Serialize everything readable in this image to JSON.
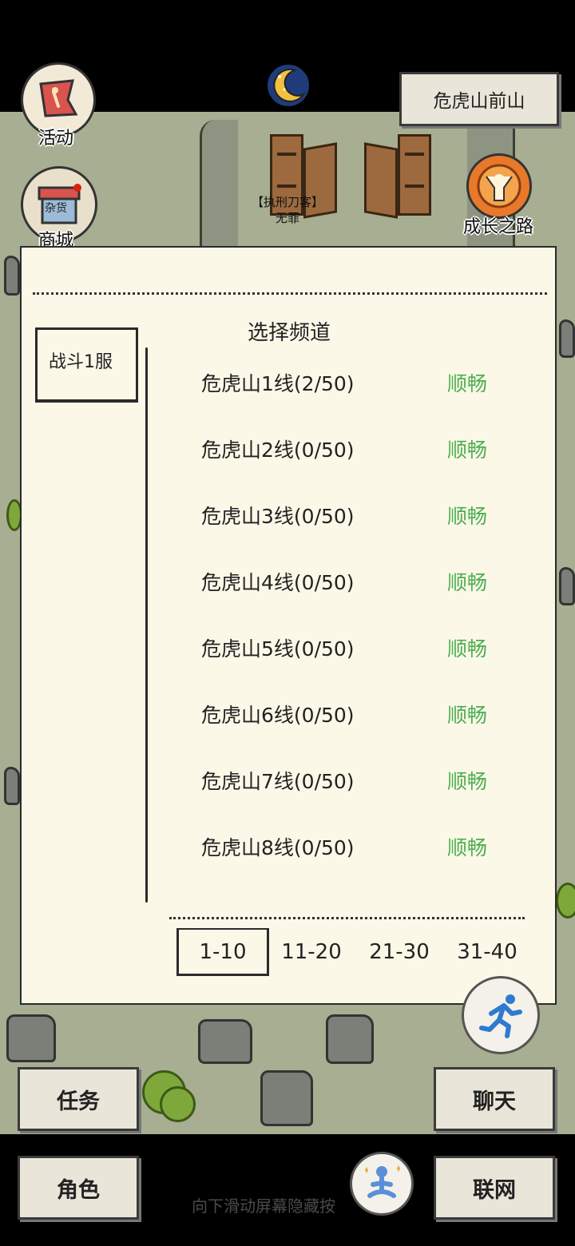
{
  "top": {
    "location": "危虎山前山",
    "activity_label": "活动",
    "shop_label": "商城",
    "shop_sign": "杂货",
    "growth_label": "成长之路"
  },
  "npc": {
    "title": "【执刑刀客】",
    "name": "无罪"
  },
  "dialog": {
    "server_tab": "战斗1服",
    "title": "选择频道",
    "channels": [
      {
        "name": "危虎山1线(2/50)",
        "status": "顺畅"
      },
      {
        "name": "危虎山2线(0/50)",
        "status": "顺畅"
      },
      {
        "name": "危虎山3线(0/50)",
        "status": "顺畅"
      },
      {
        "name": "危虎山4线(0/50)",
        "status": "顺畅"
      },
      {
        "name": "危虎山5线(0/50)",
        "status": "顺畅"
      },
      {
        "name": "危虎山6线(0/50)",
        "status": "顺畅"
      },
      {
        "name": "危虎山7线(0/50)",
        "status": "顺畅"
      },
      {
        "name": "危虎山8线(0/50)",
        "status": "顺畅"
      }
    ],
    "pages": [
      "1-10",
      "11-20",
      "21-30",
      "31-40"
    ],
    "active_page": "1-10",
    "status_color": "#4caf50"
  },
  "bottom": {
    "task": "任务",
    "chat": "聊天",
    "role": "角色",
    "network": "联网",
    "hint": "向下滑动屏幕隐藏按"
  },
  "icons": {
    "activity": "flag-icon",
    "shop": "shop-stall-icon",
    "daynight": "moon-night-icon",
    "growth": "person-cheer-icon",
    "run": "running-man-icon",
    "meditate": "meditation-icon"
  }
}
